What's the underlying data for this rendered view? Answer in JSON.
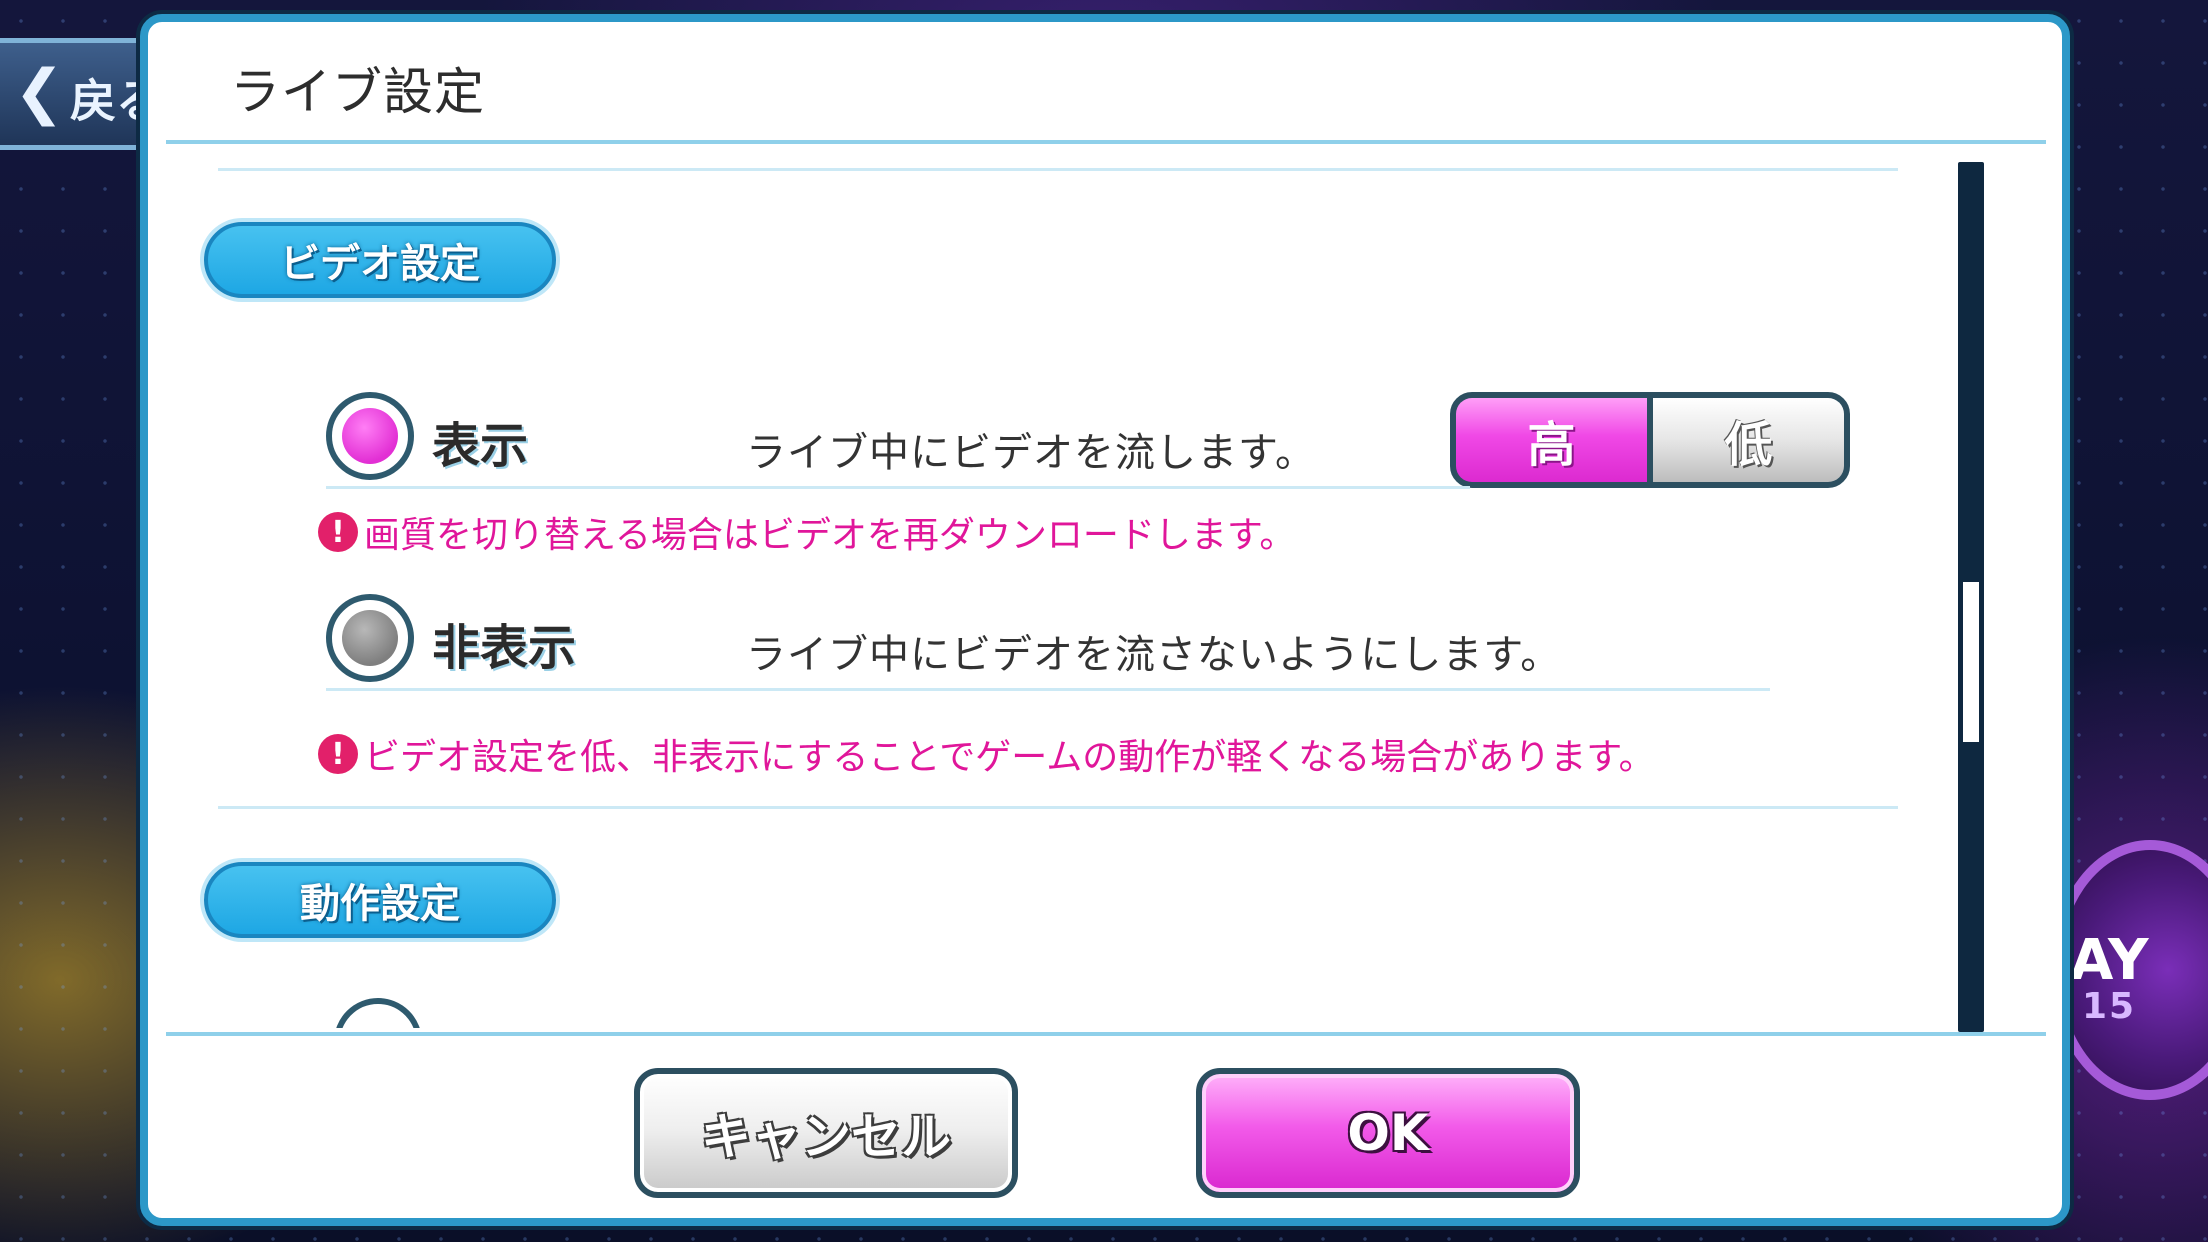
{
  "background": {
    "back_button": {
      "icon": "chevron-left-icon",
      "chevron": "❮",
      "label": "戻る"
    },
    "emblem": {
      "text": "AY",
      "number": "15"
    }
  },
  "dialog": {
    "title": "ライブ設定",
    "video_section": {
      "heading": "ビデオ設定",
      "options": [
        {
          "label": "表示",
          "selected": true,
          "description": "ライブ中にビデオを流します。"
        },
        {
          "label": "非表示",
          "selected": false,
          "description": "ライブ中にビデオを流さないようにします。"
        }
      ],
      "quality": {
        "high_label": "高",
        "low_label": "低",
        "selected": "高"
      },
      "warnings": [
        "画質を切り替える場合はビデオを再ダウンロードします。",
        "ビデオ設定を低、非表示にすることでゲームの動作が軽くなる場合があります。"
      ],
      "warning_icon": "!"
    },
    "motion_section": {
      "heading": "動作設定"
    },
    "buttons": {
      "cancel": "キャンセル",
      "ok": "OK"
    }
  },
  "colors": {
    "accent_blue": "#1ea7e4",
    "accent_pink": "#e22fd4",
    "warning_pink": "#e0169a",
    "frame": "#2c98c8"
  }
}
